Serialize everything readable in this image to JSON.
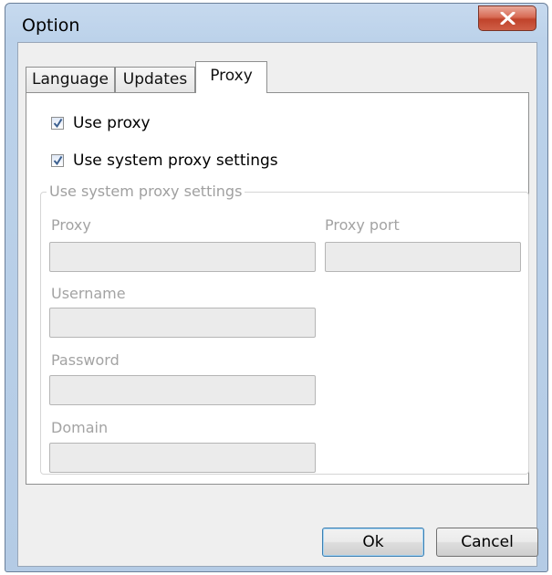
{
  "window": {
    "title": "Option",
    "close_icon": "close-icon"
  },
  "tabs": [
    {
      "label": "Language",
      "active": false
    },
    {
      "label": "Updates",
      "active": false
    },
    {
      "label": "Proxy",
      "active": true
    }
  ],
  "proxy": {
    "use_proxy": {
      "label": "Use proxy",
      "checked": true
    },
    "use_system_proxy": {
      "label": "Use system proxy settings",
      "checked": true
    },
    "group_title": "Use system proxy settings",
    "fields": {
      "proxy": {
        "label": "Proxy",
        "value": ""
      },
      "proxy_port": {
        "label": "Proxy port",
        "value": ""
      },
      "username": {
        "label": "Username",
        "value": ""
      },
      "password": {
        "label": "Password",
        "value": ""
      },
      "domain": {
        "label": "Domain",
        "value": ""
      }
    }
  },
  "buttons": {
    "ok": "Ok",
    "cancel": "Cancel"
  }
}
